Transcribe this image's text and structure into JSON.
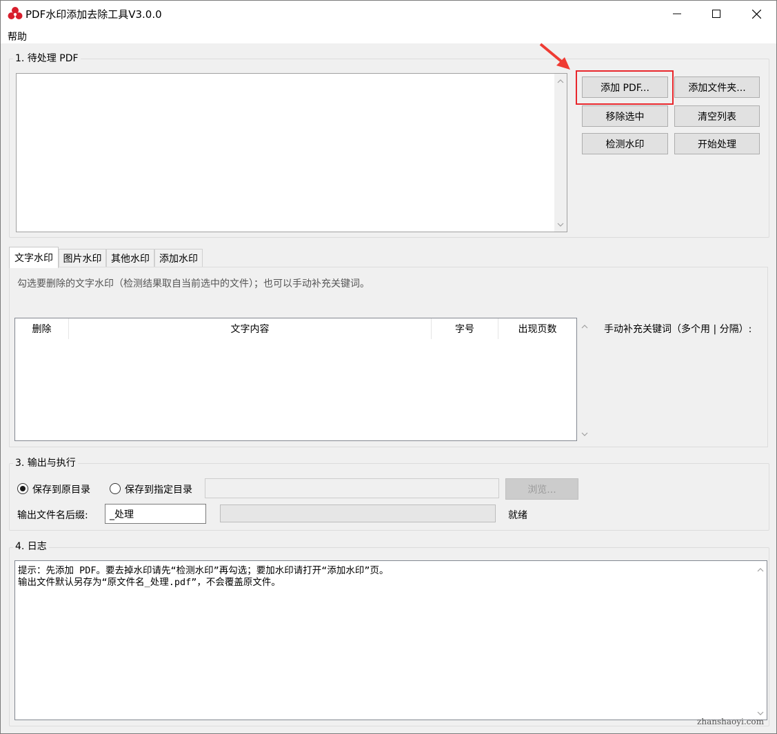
{
  "window": {
    "title": "PDF水印添加去除工具V3.0.0",
    "minimize_icon": "minimize-icon",
    "maximize_icon": "maximize-icon",
    "close_icon": "close-icon"
  },
  "menu": {
    "help": "帮助"
  },
  "section1": {
    "title": "1. 待处理 PDF",
    "buttons": {
      "add_pdf": "添加 PDF...",
      "add_folder": "添加文件夹...",
      "remove_selected": "移除选中",
      "clear_list": "清空列表",
      "detect_watermark": "检测水印",
      "start_process": "开始处理"
    }
  },
  "tabs": [
    "文字水印",
    "图片水印",
    "其他水印",
    "添加水印"
  ],
  "text_tab": {
    "hint": "勾选要删除的文字水印（检测结果取自当前选中的文件）；也可以手动补充关键词。",
    "columns": [
      "删除",
      "文字内容",
      "字号",
      "出现页数"
    ],
    "manual_label": "手动补充关键词（多个用 | 分隔）:"
  },
  "section3": {
    "title": "3. 输出与执行",
    "save_original": "保存到原目录",
    "save_custom": "保存到指定目录",
    "custom_dir_value": "",
    "browse": "浏览...",
    "suffix_label": "输出文件名后缀:",
    "suffix_value": "_处理",
    "status": "就绪",
    "selected_option": "save_original"
  },
  "section4": {
    "title": "4. 日志",
    "lines": [
      "提示：先添加 PDF。要去掉水印请先“检测水印”再勾选；要加水印请打开“添加水印”页。",
      "输出文件默认另存为“原文件名_处理.pdf”，不会覆盖原文件。"
    ]
  },
  "watermark_site": "zhanshaoyi.com",
  "colors": {
    "highlight": "#e8262b",
    "arrow": "#ef3b33"
  }
}
